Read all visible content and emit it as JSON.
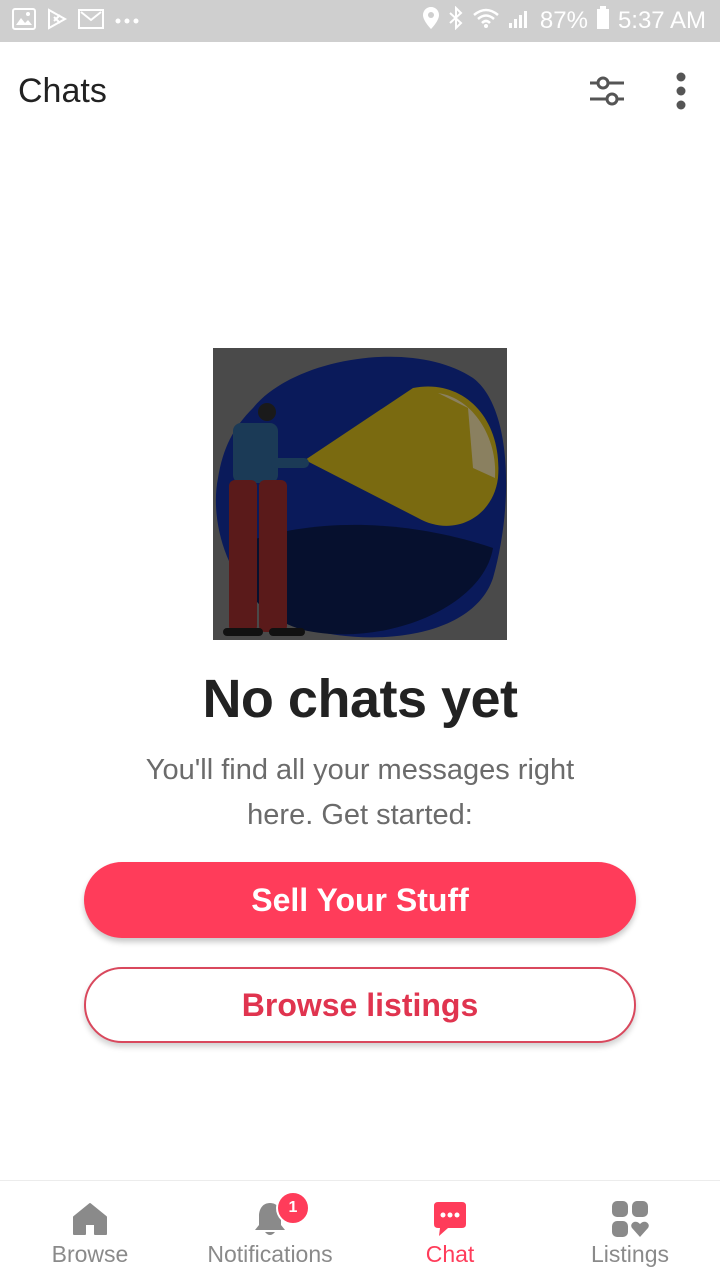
{
  "status_bar": {
    "battery": "87%",
    "time": "5:37 AM",
    "left_icons": [
      "gallery-icon",
      "play-store-icon",
      "gmail-icon",
      "more-dots-icon"
    ],
    "right_icons": [
      "location-icon",
      "bluetooth-icon",
      "wifi-icon",
      "signal-icon",
      "battery-icon"
    ]
  },
  "app_bar": {
    "title": "Chats",
    "actions": [
      "filter-icon",
      "more-vert-icon"
    ]
  },
  "empty_state": {
    "title": "No chats yet",
    "subtitle": "You'll find all your messages right here. Get started:",
    "primary_button": "Sell Your Stuff",
    "secondary_button": "Browse listings"
  },
  "bottom_nav": {
    "items": [
      {
        "label": "Browse",
        "icon": "home-icon",
        "active": false
      },
      {
        "label": "Notifications",
        "icon": "bell-icon",
        "active": false,
        "badge": "1"
      },
      {
        "label": "Chat",
        "icon": "chat-bubble-icon",
        "active": true
      },
      {
        "label": "Listings",
        "icon": "listings-grid-icon",
        "active": false
      }
    ]
  },
  "colors": {
    "accent": "#ff3c5a",
    "status_bar": "#cfcfcf",
    "title_text": "#222222",
    "subtitle_text": "#6b6b6b",
    "nav_inactive": "#8a8a8a"
  }
}
